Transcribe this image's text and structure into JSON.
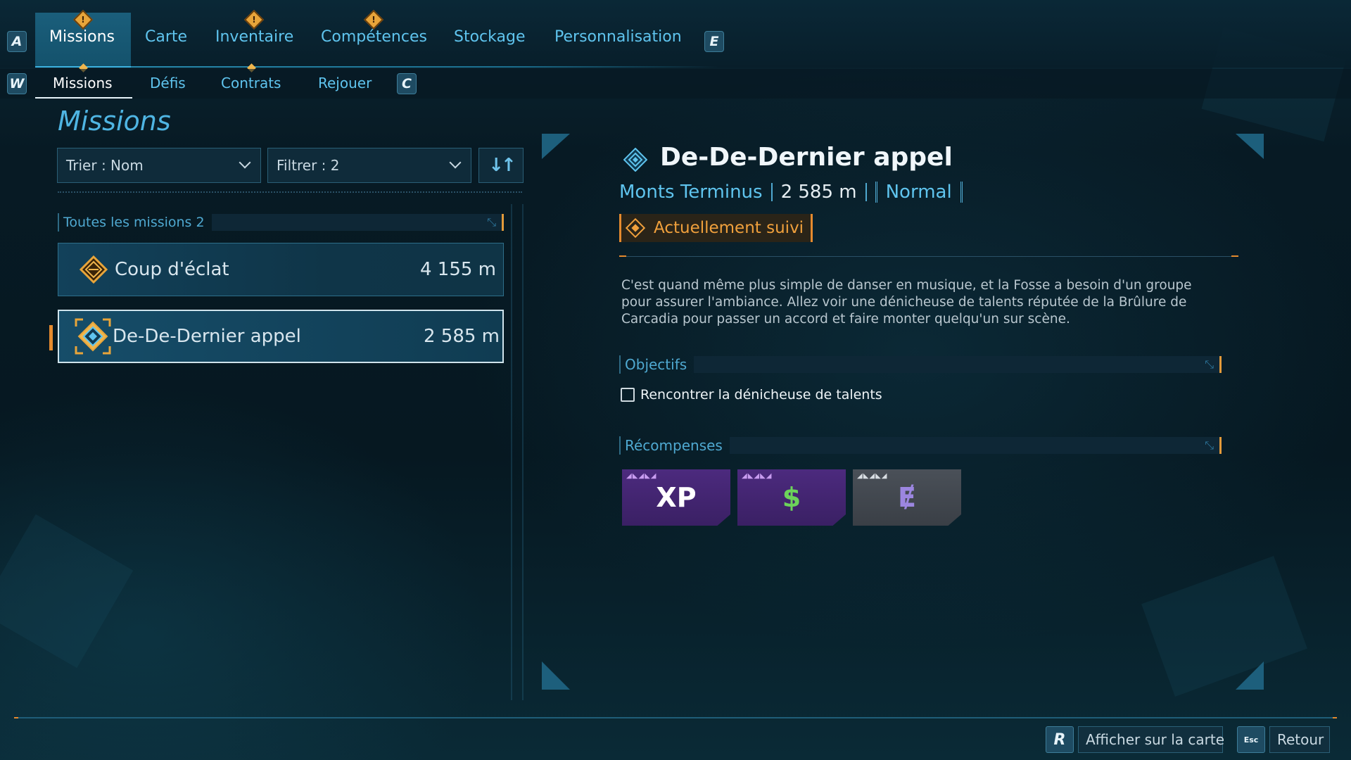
{
  "top_tabs": {
    "left_key": "A",
    "right_key": "E",
    "items": [
      {
        "label": "Missions"
      },
      {
        "label": "Carte"
      },
      {
        "label": "Inventaire"
      },
      {
        "label": "Compétences"
      },
      {
        "label": "Stockage"
      },
      {
        "label": "Personnalisation"
      }
    ],
    "alert_glyph": "!"
  },
  "sub_tabs": {
    "left_key": "W",
    "right_key": "C",
    "items": [
      {
        "label": "Missions"
      },
      {
        "label": "Défis"
      },
      {
        "label": "Contrats"
      },
      {
        "label": "Rejouer"
      }
    ]
  },
  "left_panel": {
    "title": "Missions",
    "sort_label": "Trier : Nom",
    "filter_label": "Filtrer : 2",
    "sort_direction_glyph": "↓↑",
    "list_header": "Toutes les missions 2",
    "missions": [
      {
        "name": "Coup d'éclat",
        "distance": "4 155 m",
        "icon": "gold-diamond-mission-icon"
      },
      {
        "name": "De-De-Dernier appel",
        "distance": "2 585 m",
        "icon": "blue-diamond-mission-icon",
        "selected": true
      }
    ]
  },
  "detail": {
    "title": "De-De-Dernier appel",
    "location": "Monts Terminus",
    "distance": "2 585 m",
    "difficulty": "Normal",
    "tracked_label": "Actuellement suivi",
    "description": "C'est quand même plus simple de danser en musique, et la Fosse a besoin d'un groupe pour assurer l'ambiance. Allez voir une dénicheuse de talents réputée de la Brûlure de Carcadia pour passer un accord et faire monter quelqu'un sur scène.",
    "objectives_header": "Objectifs",
    "objectives": [
      {
        "text": "Rencontrer la dénicheuse de talents",
        "completed": false
      }
    ],
    "rewards_header": "Récompenses",
    "rewards": [
      {
        "glyph": "XP",
        "icon": "xp-icon",
        "tier": "purple"
      },
      {
        "glyph": "$",
        "icon": "cash-icon",
        "tier": "purple"
      },
      {
        "glyph": "Ɇ",
        "icon": "eridium-icon",
        "tier": "grey"
      }
    ]
  },
  "footer": {
    "map_key": "R",
    "map_label": "Afficher sur la carte",
    "back_key": "Esc",
    "back_label": "Retour"
  },
  "colors": {
    "accent_blue": "#5fc4ee",
    "accent_orange": "#e58a2e",
    "background": "#061821"
  }
}
